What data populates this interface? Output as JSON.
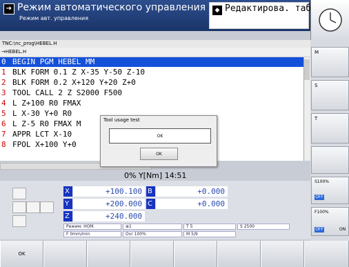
{
  "header": {
    "mode_title": "Режим автоматического управления",
    "mode_subtitle": "Режим авт. управления",
    "edit_title": "Редактирова. таб…"
  },
  "path": "TNC:\\nc_prog\\HEBEL.H",
  "file_tab": "→HEBEL.H",
  "program": [
    {
      "num": "0",
      "text": "BEGIN PGM HEBEL MM"
    },
    {
      "num": "1",
      "text": "BLK FORM 0.1 Z X-35 Y-50 Z-10"
    },
    {
      "num": "2",
      "text": "BLK FORM 0.2  X+120  Y+20  Z+0"
    },
    {
      "num": "3",
      "text": "TOOL CALL 2 Z S2000 F500"
    },
    {
      "num": "4",
      "text": "L  Z+100 R0 FMAX"
    },
    {
      "num": "5",
      "text": "L  X-30  Y+0 R0"
    },
    {
      "num": "6",
      "text": "L  Z-5 R0 FMAX M"
    },
    {
      "num": "7",
      "text": "APPR LCT  X-10"
    },
    {
      "num": "8",
      "text": "FPOL  X+100  Y+0"
    }
  ],
  "status": {
    "override_text": "0% Y[Nm]  14:51"
  },
  "axes": [
    {
      "label": "X",
      "value": "+100.100",
      "label2": "B",
      "value2": "+0.000"
    },
    {
      "label": "Y",
      "value": "+200.000",
      "label2": "C",
      "value2": "+0.000"
    },
    {
      "label": "Z",
      "value": "+240.000"
    }
  ],
  "info": {
    "mode": "Режим: HOM.",
    "tool": "T 5",
    "feed": "F 0mm/min",
    "ovr": "Ovr 100%",
    "spindle": "S 2500",
    "mcode": "M 5/9",
    "spindle_icon": "1"
  },
  "dialog": {
    "title": "Tool usage test",
    "message": "OK",
    "button": "OK"
  },
  "softkeys": [
    "OK",
    "",
    "",
    "",
    "",
    "",
    "",
    ""
  ],
  "right": {
    "m": "M",
    "s": "S",
    "t": "T",
    "s100": "S100%",
    "f100": "F100%",
    "off": "OFF",
    "on": "ON"
  }
}
